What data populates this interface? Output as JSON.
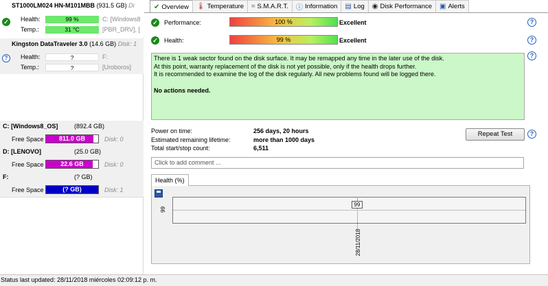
{
  "disks": [
    {
      "title": "ST1000LM024 HN-M101MBB",
      "size": "(931.5 GB)",
      "tail": "Di",
      "health_label": "Health:",
      "health_value": "99 %",
      "health_extra": "C: [Windows8",
      "temp_label": "Temp.:",
      "temp_value": "31 °C",
      "temp_extra": "[PBR_DRV],  [",
      "status": "ok"
    },
    {
      "title": "Kingston DataTraveler 3.0",
      "size": "(14.6 GB)",
      "tail": "Disk: 1",
      "health_label": "Health:",
      "health_value": "?",
      "health_extra": "F:",
      "temp_label": "Temp.:",
      "temp_value": "?",
      "temp_extra": "[Uroboros]",
      "status": "unknown"
    }
  ],
  "volumes": [
    {
      "name": "C: [Windows8_OS]",
      "size": "(892.4 GB)",
      "fs_label": "Free Space",
      "free": "811.0 GB",
      "free_fraction": 0.91,
      "disk": "Disk: 0",
      "color": "#cc00cc"
    },
    {
      "name": "D: [LENOVO]",
      "size": "(25.0 GB)",
      "fs_label": "Free Space",
      "free": "22.6 GB",
      "free_fraction": 0.9,
      "disk": "Disk: 0",
      "color": "#cc00cc"
    },
    {
      "name": "F:",
      "size": "(? GB)",
      "fs_label": "Free Space",
      "free": "(? GB)",
      "free_fraction": 1.0,
      "disk": "Disk: 1",
      "color": "#0000c8"
    }
  ],
  "tabs": [
    {
      "label": "Overview",
      "icon": "check-icon"
    },
    {
      "label": "Temperature",
      "icon": "thermometer-icon"
    },
    {
      "label": "S.M.A.R.T.",
      "icon": "smart-icon"
    },
    {
      "label": "Information",
      "icon": "info-icon"
    },
    {
      "label": "Log",
      "icon": "log-icon"
    },
    {
      "label": "Disk Performance",
      "icon": "performance-icon"
    },
    {
      "label": "Alerts",
      "icon": "alerts-icon"
    }
  ],
  "overview": {
    "performance_label": "Performance:",
    "performance_value": "100 %",
    "performance_fraction": 1.0,
    "performance_text": "Excellent",
    "health_label": "Health:",
    "health_value": "99 %",
    "health_fraction": 0.99,
    "health_text": "Excellent",
    "message_lines": [
      "There is 1 weak sector found on the disk surface. It may be remapped any time in the later use of the disk.",
      "At this point, warranty replacement of the disk is not yet possible, only if the health drops further.",
      "It is recommended to examine the log of the disk regularly. All new problems found will be logged there."
    ],
    "message_strong": "No actions needed.",
    "power_on_label": "Power on time:",
    "power_on_value": "256 days, 20 hours",
    "lifetime_label": "Estimated remaining lifetime:",
    "lifetime_value": "more than 1000 days",
    "startstop_label": "Total start/stop count:",
    "startstop_value": "6,511",
    "repeat_button": "Repeat Test",
    "comment_placeholder": "Click to add comment ..."
  },
  "chart_data": {
    "type": "line",
    "title": "Health (%)",
    "x": [
      "28/11/2018"
    ],
    "series": [
      {
        "values": [
          99
        ]
      }
    ],
    "ytick": "99",
    "point_label": "99",
    "grid": false
  },
  "statusbar": {
    "text": "Status last updated: 28/11/2018 miércoles 02:09:12 p. m."
  },
  "colors": {
    "health_good": "#6ee86e",
    "message_bg": "#ccf7c8",
    "accent_blue": "#1f5fbf"
  }
}
